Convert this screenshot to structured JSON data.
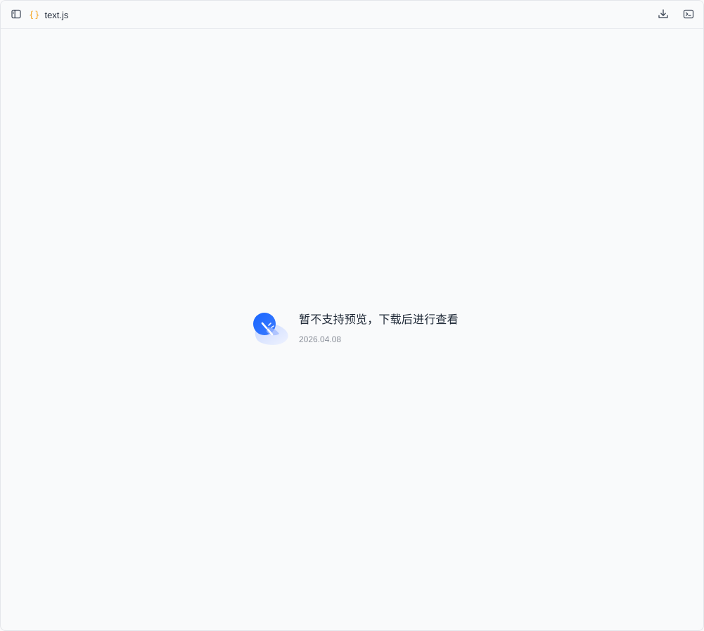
{
  "toolbar": {
    "file_icon_glyph": "{}",
    "file_name": "text.js"
  },
  "empty_state": {
    "message": "暂不支持预览，下载后进行查看",
    "date": "2026.04.08"
  },
  "colors": {
    "accent": "#1a66ff",
    "file_icon": "#f5a623",
    "text_primary": "#1f2937",
    "text_secondary": "#8a8f99",
    "background": "#f9fafb"
  },
  "icons": {
    "sidebar_toggle": "sidebar-panel-icon",
    "file": "curly-braces-icon",
    "download": "download-icon",
    "terminal": "terminal-icon",
    "preview_unavailable": "broken-link-illustration"
  }
}
